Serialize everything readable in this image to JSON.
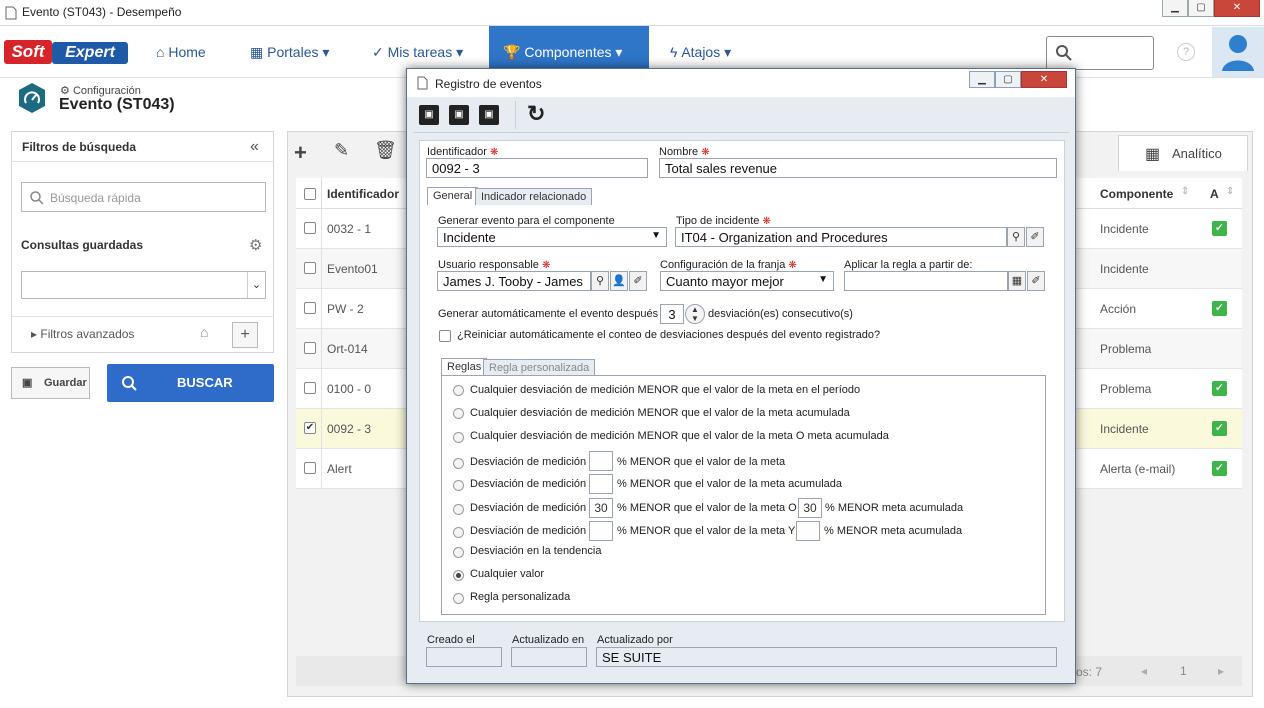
{
  "window": {
    "title": "Evento (ST043) - Desempeño",
    "min": "▁",
    "max": "▢",
    "close": "✕"
  },
  "brand": {
    "soft": "Soft",
    "expert": "Expert"
  },
  "nav": {
    "home": "Home",
    "portales": "Portales",
    "mis_tareas": "Mis tareas",
    "componentes": "Componentes",
    "atajos": "Atajos"
  },
  "header": {
    "section": "Configuración",
    "title": "Evento (ST043)"
  },
  "filters": {
    "title": "Filtros de búsqueda",
    "quick_placeholder": "Búsqueda rápida",
    "saved": "Consultas guardadas",
    "advanced": "Filtros avanzados",
    "save_btn": "Guardar",
    "search_btn": "BUSCAR"
  },
  "grid": {
    "tab_analitico": "Analítico",
    "col_id": "Identificador",
    "col_comp": "Componente",
    "col_a": "A",
    "rows": [
      {
        "id": "0032 - 1",
        "comp": "Incidente",
        "checked": false,
        "a": true
      },
      {
        "id": "Evento01",
        "comp": "Incidente",
        "checked": false,
        "a": false
      },
      {
        "id": "PW - 2",
        "comp": "Acción",
        "checked": false,
        "a": true
      },
      {
        "id": "Ort-014",
        "comp": "Problema",
        "checked": false,
        "a": false
      },
      {
        "id": "0100 - 0",
        "comp": "Problema",
        "checked": false,
        "a": true
      },
      {
        "id": "0092 - 3",
        "comp": "Incidente",
        "checked": true,
        "a": true
      },
      {
        "id": "Alert",
        "comp": "Alerta (e-mail)",
        "checked": false,
        "a": true
      }
    ],
    "footer_count": "ros: 7",
    "page": "1"
  },
  "modal": {
    "title": "Registro de eventos",
    "id_label": "Identificador",
    "id_value": "0092 - 3",
    "name_label": "Nombre",
    "name_value": "Total sales revenue",
    "tab_general": "General",
    "tab_related": "Indicador relacionado",
    "gen_comp_label": "Generar evento para el componente",
    "gen_comp_value": "Incidente",
    "tipo_label": "Tipo de incidente",
    "tipo_value": "IT04 - Organization and Procedures",
    "user_label": "Usuario responsable",
    "user_value": "James J. Tooby - James",
    "franja_label": "Configuración de la franja",
    "franja_value": "Cuanto mayor mejor",
    "aplicar_label": "Aplicar la regla a partir de:",
    "gen_auto_pre": "Generar automáticamente el evento después",
    "gen_auto_value": "3",
    "gen_auto_post": "desviación(es) consecutivo(s)",
    "restart_label": "¿Reiniciar automáticamente el conteo de desviaciones después del evento registrado?",
    "tab_reglas": "Reglas",
    "tab_regla_pers": "Regla personalizada",
    "rules": {
      "r1": "Cualquier desviación de medición MENOR que el valor de la meta en el período",
      "r2": "Cualquier desviación de medición MENOR que el valor de la meta acumulada",
      "r3": "Cualquier desviación de medición MENOR que el valor de la meta O meta acumulada",
      "r4a": "Desviación de medición",
      "r4b": "% MENOR que el valor de la meta",
      "r5a": "Desviación de medición",
      "r5b": "% MENOR que el valor de la meta acumulada",
      "r6a": "Desviación de medición",
      "r6v1": "30",
      "r6b": "% MENOR que el valor de la meta O",
      "r6v2": "30",
      "r6c": "% MENOR meta acumulada",
      "r7a": "Desviación de medición",
      "r7b": "% MENOR que el valor de la meta Y",
      "r7c": "% MENOR meta acumulada",
      "r8": "Desviación en la tendencia",
      "r9": "Cualquier valor",
      "r10": "Regla personalizada"
    },
    "created_label": "Creado el",
    "updated_on_label": "Actualizado en",
    "updated_by_label": "Actualizado por",
    "updated_by_value": "SE SUITE"
  }
}
